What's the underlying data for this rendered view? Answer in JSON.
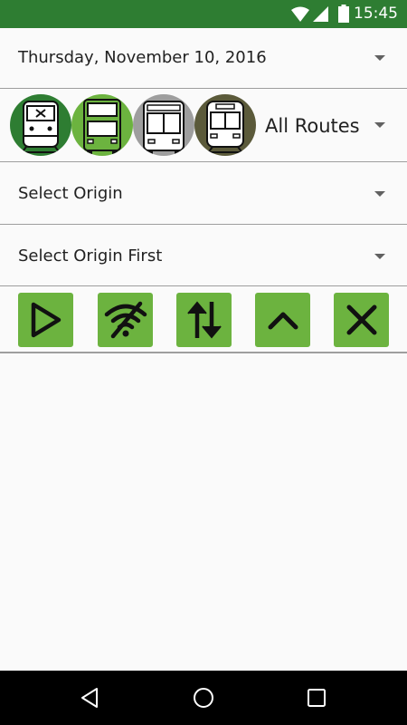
{
  "status_bar": {
    "time": "15:45",
    "icons": [
      "wifi-icon",
      "cell-signal-icon",
      "battery-icon"
    ],
    "background": "#2e7d32"
  },
  "date_selector": {
    "value": "Thursday, November 10, 2016"
  },
  "route_selector": {
    "value": "All Routes",
    "mode_icons": [
      {
        "name": "commuter-train-icon",
        "circle_color": "#2e7d32"
      },
      {
        "name": "double-decker-bus-icon",
        "circle_color": "#6cb33f"
      },
      {
        "name": "city-bus-icon",
        "circle_color": "#9e9e9e"
      },
      {
        "name": "light-rail-icon",
        "circle_color": "#5b5a3a"
      }
    ]
  },
  "origin_selector": {
    "value": "Select Origin"
  },
  "destination_selector": {
    "value": "Select Origin First"
  },
  "toolbar": {
    "button_color": "#6cb33f",
    "buttons": [
      {
        "name": "play-icon"
      },
      {
        "name": "wifi-off-icon"
      },
      {
        "name": "swap-vertical-icon"
      },
      {
        "name": "chevron-up-icon"
      },
      {
        "name": "close-icon"
      }
    ]
  },
  "nav_bar": {
    "buttons": [
      "back-icon",
      "home-icon",
      "recents-icon"
    ]
  }
}
